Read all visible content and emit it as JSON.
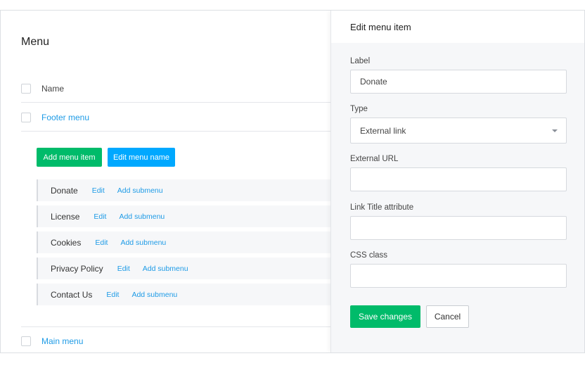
{
  "menu": {
    "title": "Menu",
    "column_header": "Name",
    "menus": [
      {
        "name": "Footer menu"
      },
      {
        "name": "Main menu"
      }
    ],
    "buttons": {
      "add_item": "Add menu item",
      "edit_name": "Edit menu name"
    },
    "items": [
      {
        "name": "Donate",
        "edit": "Edit",
        "add_submenu": "Add submenu"
      },
      {
        "name": "License",
        "edit": "Edit",
        "add_submenu": "Add submenu"
      },
      {
        "name": "Cookies",
        "edit": "Edit",
        "add_submenu": "Add submenu"
      },
      {
        "name": "Privacy Policy",
        "edit": "Edit",
        "add_submenu": "Add submenu"
      },
      {
        "name": "Contact Us",
        "edit": "Edit",
        "add_submenu": "Add submenu"
      }
    ]
  },
  "edit_panel": {
    "title": "Edit menu item",
    "fields": {
      "label": {
        "label": "Label",
        "value": "Donate"
      },
      "type": {
        "label": "Type",
        "value": "External link"
      },
      "external_url": {
        "label": "External URL",
        "value": ""
      },
      "link_title": {
        "label": "Link Title attribute",
        "value": ""
      },
      "css_class": {
        "label": "CSS class",
        "value": ""
      }
    },
    "save_label": "Save changes",
    "cancel_label": "Cancel"
  },
  "colors": {
    "primary_green": "#00bb6a",
    "primary_blue": "#00a8ff",
    "link_blue": "#1e9be6"
  }
}
